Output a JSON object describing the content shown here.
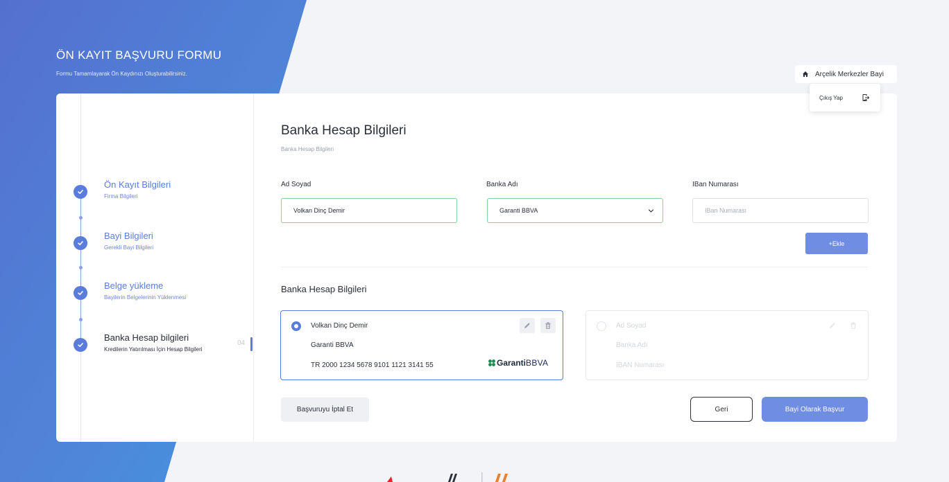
{
  "header": {
    "title": "ÖN KAYIT BAŞVURU FORMU",
    "subtitle": "Formu Tamamlayarak Ön Kaydınızı Oluşturabilirsiniz."
  },
  "user_menu": {
    "name": "Arçelik Merkezler Bayi",
    "logout_label": "Çıkış Yap"
  },
  "steps": [
    {
      "title": "Ön Kayıt Bilgileri",
      "subtitle": "Firma Bilgileri"
    },
    {
      "title": "Bayi Bilgileri",
      "subtitle": "Gerekli Bayi Bilgileri"
    },
    {
      "title": "Belge yükleme",
      "subtitle": "Bayilerin Belgelerinin Yüklenmesi"
    },
    {
      "title": "Banka Hesap bilgileri",
      "subtitle": "Kredilerin Yatırılması İçin Hesap Bilgileri"
    }
  ],
  "current_step_number": "04",
  "form": {
    "title": "Banka Hesap Bilgileri",
    "subtitle": "Banka Hesap Bilgileri",
    "fields": {
      "name": {
        "label": "Ad Soyad",
        "value": "Volkan Dinç Demir"
      },
      "bank": {
        "label": "Banka Adı",
        "value": "Garanti BBVA"
      },
      "iban": {
        "label": "IBan Numarası",
        "placeholder": "IBan Numarası"
      }
    },
    "add_label": "+Ekle"
  },
  "accounts_section": {
    "title": "Banka Hesap Bilgileri",
    "accounts": [
      {
        "name": "Volkan Dinç Demir",
        "bank": "Garanti BBVA",
        "iban": "TR 2000 1234 5678 9101 1121 3141 55",
        "logo_text": "Garanti",
        "logo_suffix": "BBVA",
        "selected": true
      },
      {
        "name": "Ad Soyad",
        "bank": "Banka Adı",
        "iban": "IBAN Numarası",
        "selected": false
      }
    ]
  },
  "actions": {
    "cancel_label": "Başvuruyu İptal Et",
    "back_label": "Geri",
    "apply_label": "Bayi Olarak Başvur"
  },
  "colors": {
    "accent": "#5a7ddc",
    "button": "#6f8de3",
    "success_border": "#8ad19a"
  }
}
